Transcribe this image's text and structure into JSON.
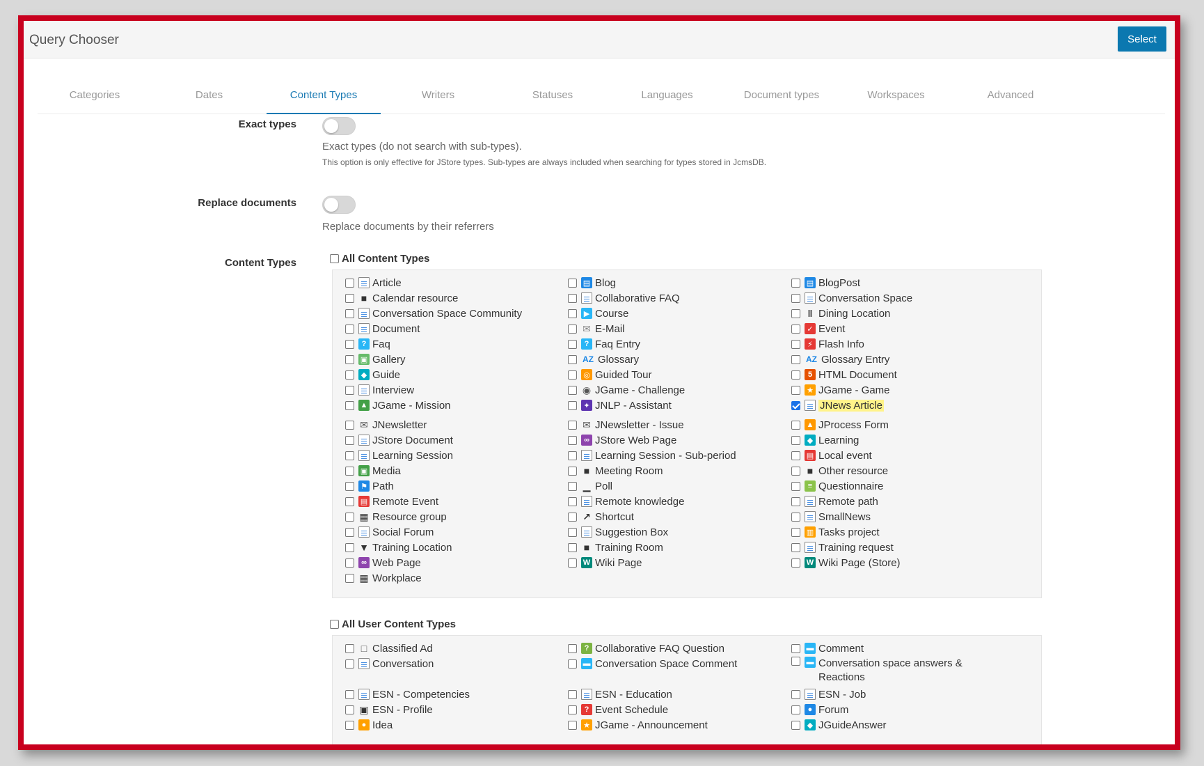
{
  "header": {
    "title": "Query Chooser",
    "select_label": "Select"
  },
  "tabs": [
    "Categories",
    "Dates",
    "Content Types",
    "Writers",
    "Statuses",
    "Languages",
    "Document types",
    "Workspaces",
    "Advanced"
  ],
  "active_tab": "Content Types",
  "exact_types": {
    "label": "Exact types",
    "help": "Exact types (do not search with sub-types).",
    "note": "This option is only effective for JStore types. Sub-types are always included when searching for types stored in JcmsDB."
  },
  "replace_docs": {
    "label": "Replace documents",
    "help": "Replace documents by their referrers"
  },
  "content_types": {
    "label": "Content Types",
    "all_label": "All Content Types",
    "items": [
      {
        "label": "Article",
        "icon": "doc-icon",
        "color": "#4a90e2"
      },
      {
        "label": "Blog",
        "icon": "blog-icon",
        "color": "#1e88e5"
      },
      {
        "label": "BlogPost",
        "icon": "blogpost-icon",
        "color": "#1e88e5"
      },
      {
        "label": "Calendar resource",
        "icon": "projector-icon",
        "color": "#333333"
      },
      {
        "label": "Collaborative FAQ",
        "icon": "doc-icon",
        "color": "#4a90e2"
      },
      {
        "label": "Conversation Space",
        "icon": "doc-icon",
        "color": "#4a90e2"
      },
      {
        "label": "Conversation Space Community",
        "icon": "doc-icon",
        "color": "#4a90e2"
      },
      {
        "label": "Course",
        "icon": "course-icon",
        "color": "#29b6f6"
      },
      {
        "label": "Dining Location",
        "icon": "fork-knife-icon",
        "color": "#333333"
      },
      {
        "label": "Document",
        "icon": "doc-icon",
        "color": "#888888"
      },
      {
        "label": "E-Mail",
        "icon": "mail-icon",
        "color": "#888888"
      },
      {
        "label": "Event",
        "icon": "calendar-check-icon",
        "color": "#e53935"
      },
      {
        "label": "Faq",
        "icon": "question-icon",
        "color": "#29b6f6"
      },
      {
        "label": "Faq Entry",
        "icon": "question-icon",
        "color": "#29b6f6"
      },
      {
        "label": "Flash Info",
        "icon": "flash-icon",
        "color": "#e53935"
      },
      {
        "label": "Gallery",
        "icon": "gallery-icon",
        "color": "#66bb6a"
      },
      {
        "label": "Glossary",
        "icon": "az-icon",
        "color": "#1e88e5"
      },
      {
        "label": "Glossary Entry",
        "icon": "az-icon",
        "color": "#1e88e5"
      },
      {
        "label": "Guide",
        "icon": "graduation-cap-icon",
        "color": "#00acc1"
      },
      {
        "label": "Guided Tour",
        "icon": "compass-icon",
        "color": "#ff9800"
      },
      {
        "label": "HTML Document",
        "icon": "html5-icon",
        "color": "#e65100"
      },
      {
        "label": "Interview",
        "icon": "doc-icon",
        "color": "#4a90e2"
      },
      {
        "label": "JGame - Challenge",
        "icon": "target-icon",
        "color": "#555555"
      },
      {
        "label": "JGame - Game",
        "icon": "trophy-icon",
        "color": "#ffa000"
      },
      {
        "label": "JGame - Mission",
        "icon": "flask-icon",
        "color": "#43a047"
      },
      {
        "label": "JNLP - Assistant",
        "icon": "sparkle-icon",
        "color": "#5e35b1"
      },
      {
        "label": "JNews Article",
        "icon": "doc-icon",
        "color": "#4a90e2",
        "checked": true,
        "highlight": true
      },
      {
        "label": "JNewsletter",
        "icon": "newsletter-icon",
        "color": "#555555"
      },
      {
        "label": "JNewsletter - Issue",
        "icon": "newsletter-icon",
        "color": "#555555"
      },
      {
        "label": "JProcess Form",
        "icon": "bell-icon",
        "color": "#ff9800"
      },
      {
        "label": "JStore Document",
        "icon": "doc-icon",
        "color": "#888888"
      },
      {
        "label": "JStore Web Page",
        "icon": "link-icon",
        "color": "#8e44ad"
      },
      {
        "label": "Learning",
        "icon": "graduation-cap-icon",
        "color": "#00acc1"
      },
      {
        "label": "Learning Session",
        "icon": "doc-icon",
        "color": "#4a90e2"
      },
      {
        "label": "Learning Session - Sub-period",
        "icon": "doc-icon",
        "color": "#4a90e2"
      },
      {
        "label": "Local event",
        "icon": "calendar-icon",
        "color": "#e53935"
      },
      {
        "label": "Media",
        "icon": "media-icon",
        "color": "#43a047"
      },
      {
        "label": "Meeting Room",
        "icon": "projector-icon",
        "color": "#333333"
      },
      {
        "label": "Other resource",
        "icon": "projector-icon",
        "color": "#333333"
      },
      {
        "label": "Path",
        "icon": "flag-icon",
        "color": "#1e88e5"
      },
      {
        "label": "Poll",
        "icon": "bar-chart-icon",
        "color": "#333333"
      },
      {
        "label": "Questionnaire",
        "icon": "list-icon",
        "color": "#8bc34a"
      },
      {
        "label": "Remote Event",
        "icon": "calendar-icon",
        "color": "#e53935"
      },
      {
        "label": "Remote knowledge",
        "icon": "doc-icon",
        "color": "#4a90e2"
      },
      {
        "label": "Remote path",
        "icon": "doc-icon",
        "color": "#4a90e2"
      },
      {
        "label": "Resource group",
        "icon": "building-icon",
        "color": "#333333"
      },
      {
        "label": "Shortcut",
        "icon": "external-link-icon",
        "color": "#333333"
      },
      {
        "label": "SmallNews",
        "icon": "doc-icon",
        "color": "#4a90e2"
      },
      {
        "label": "Social Forum",
        "icon": "doc-icon",
        "color": "#4a90e2"
      },
      {
        "label": "Suggestion Box",
        "icon": "doc-icon",
        "color": "#4a90e2"
      },
      {
        "label": "Tasks project",
        "icon": "tasks-icon",
        "color": "#ffa000"
      },
      {
        "label": "Training Location",
        "icon": "map-pin-icon",
        "color": "#333333"
      },
      {
        "label": "Training Room",
        "icon": "projector-icon",
        "color": "#333333"
      },
      {
        "label": "Training request",
        "icon": "doc-icon",
        "color": "#4a90e2"
      },
      {
        "label": "Web Page",
        "icon": "link-icon",
        "color": "#8e44ad"
      },
      {
        "label": "Wiki Page",
        "icon": "wiki-icon",
        "color": "#00897b"
      },
      {
        "label": "Wiki Page (Store)",
        "icon": "wiki-icon",
        "color": "#00897b"
      },
      {
        "label": "Workplace",
        "icon": "building-icon",
        "color": "#333333"
      }
    ]
  },
  "user_content_types": {
    "all_label": "All User Content Types",
    "items": [
      {
        "label": "Classified Ad",
        "icon": "cart-icon",
        "color": "#555555"
      },
      {
        "label": "Collaborative FAQ Question",
        "icon": "question-icon",
        "color": "#7cb342"
      },
      {
        "label": "Comment",
        "icon": "comment-icon",
        "color": "#29b6f6"
      },
      {
        "label": "Conversation",
        "icon": "doc-icon",
        "color": "#4a90e2"
      },
      {
        "label": "Conversation Space Comment",
        "icon": "comment-icon",
        "color": "#29b6f6"
      },
      {
        "label": "Conversation space answers & Reactions",
        "icon": "comment-icon",
        "color": "#29b6f6"
      },
      {
        "label": "ESN - Competencies",
        "icon": "doc-icon",
        "color": "#4a90e2"
      },
      {
        "label": "ESN - Education",
        "icon": "doc-icon",
        "color": "#4a90e2"
      },
      {
        "label": "ESN - Job",
        "icon": "doc-icon",
        "color": "#4a90e2"
      },
      {
        "label": "ESN - Profile",
        "icon": "profile-icon",
        "color": "#333333"
      },
      {
        "label": "Event Schedule",
        "icon": "calendar-question-icon",
        "color": "#e53935"
      },
      {
        "label": "Forum",
        "icon": "forum-icon",
        "color": "#1e88e5"
      },
      {
        "label": "Idea",
        "icon": "lightbulb-icon",
        "color": "#ffa000"
      },
      {
        "label": "JGame - Announcement",
        "icon": "trophy-icon",
        "color": "#ffa000"
      },
      {
        "label": "JGuideAnswer",
        "icon": "graduation-cap-icon",
        "color": "#00acc1"
      }
    ]
  }
}
